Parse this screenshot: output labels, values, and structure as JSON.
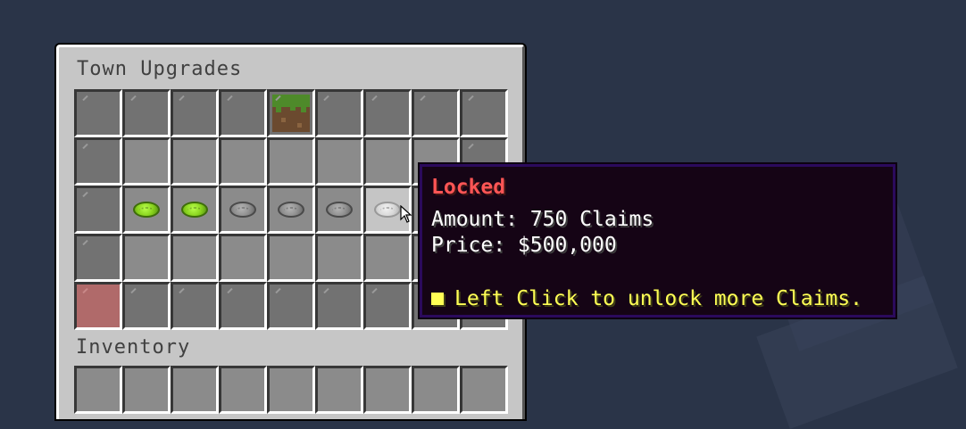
{
  "container": {
    "title": "Town Upgrades",
    "inventory_title": "Inventory"
  },
  "upgrades": {
    "items": {
      "grass_block": "grass-block-icon",
      "unlocked": "lime-disc-icon",
      "locked": "gray-disc-icon",
      "hovered": "light-gray-disc-icon",
      "filler": "gray-glass-pane-icon",
      "back": "red-glass-pane-icon"
    },
    "unlocked_count": 2,
    "locked_count": 4
  },
  "tooltip": {
    "title": "Locked",
    "amount": "Amount: 750 Claims",
    "price": "Price: $500,000",
    "hint": "Left Click to unlock more Claims.",
    "colors": {
      "title": "#ff5555",
      "text": "#ffffff",
      "hint": "#ffff55",
      "background": "#150415",
      "border": "#2b0a5c"
    }
  },
  "colors": {
    "background": "#2a3448",
    "panel": "#c6c6c6",
    "slot": "#8b8b8b"
  }
}
